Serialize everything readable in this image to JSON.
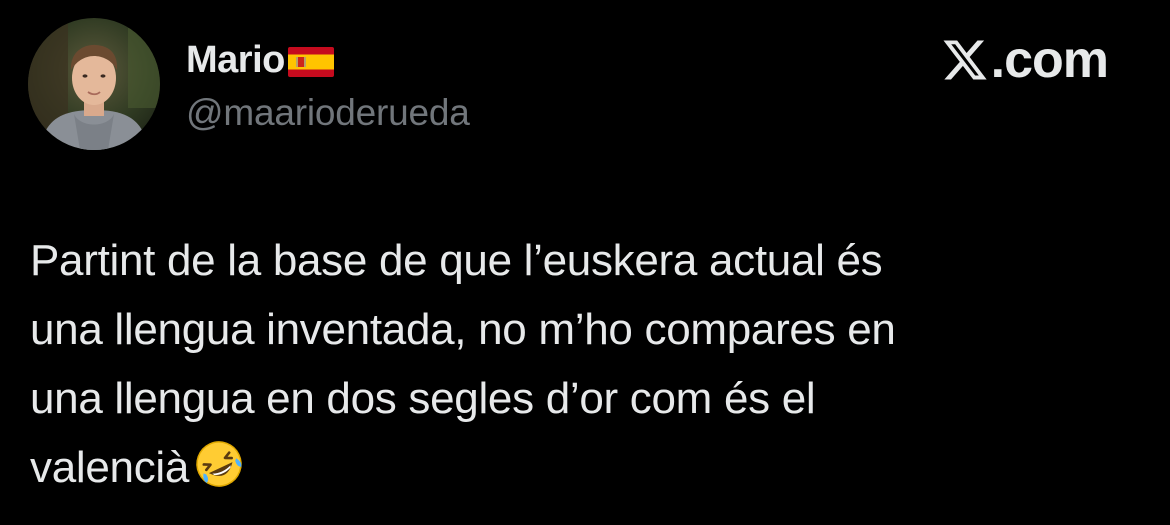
{
  "author": {
    "display_name": "Mario",
    "flag_icon": "spain-flag-icon",
    "handle": "@maarioderueda"
  },
  "brand": {
    "icon": "x-logo-icon",
    "label": ".com"
  },
  "tweet": {
    "lines": [
      "Partint de la base de que l’euskera actual és",
      "una llengua inventada, no m’ho compares en",
      "una llengua en dos segles d’or com és el",
      "valencià"
    ],
    "trailing_emoji": "rolling-on-floor-laughing-emoji"
  },
  "colors": {
    "background": "#000000",
    "primary_text": "#e7e9ea",
    "secondary_text": "#71767b"
  }
}
